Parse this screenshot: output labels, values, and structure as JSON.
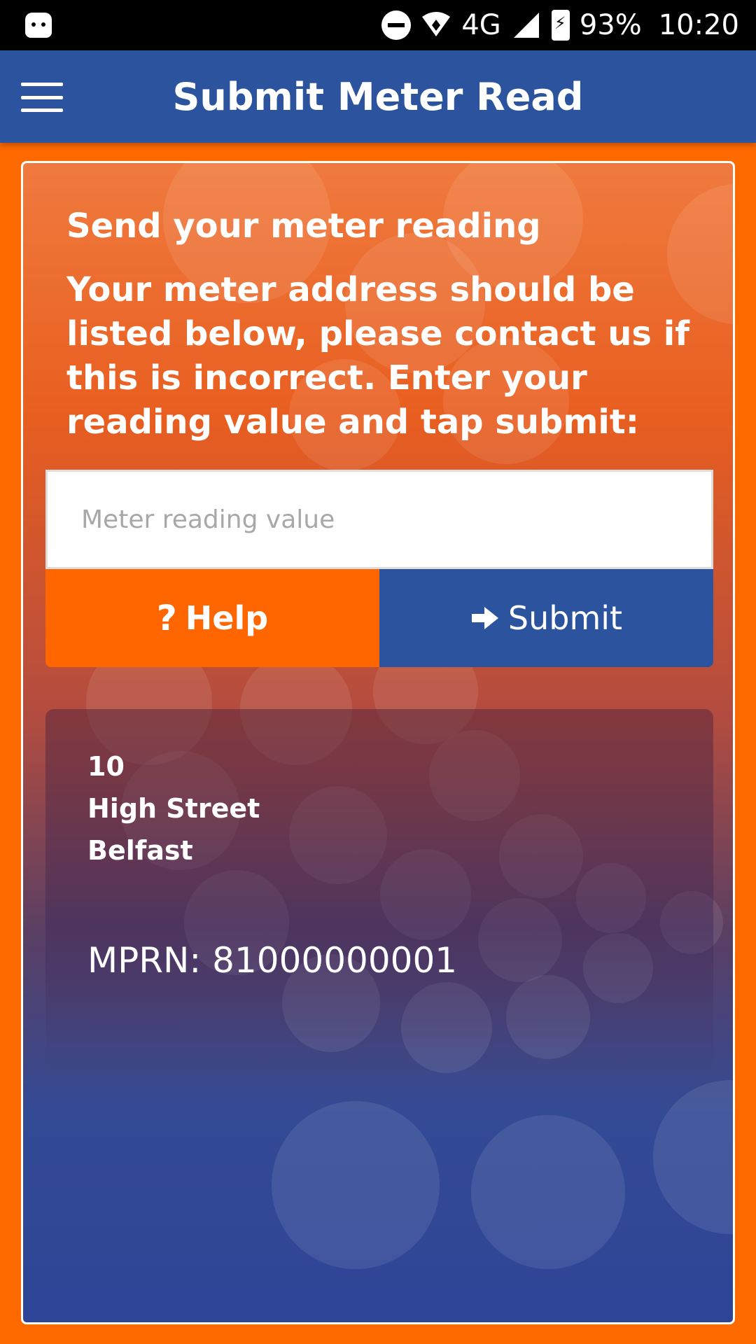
{
  "status_bar": {
    "battery": "93%",
    "time": "10:20",
    "network": "4G"
  },
  "header": {
    "title": "Submit Meter Read"
  },
  "form": {
    "heading": "Send your meter reading",
    "intro": "Your meter address should be listed below, please contact us if this is incorrect. Enter your reading value and tap submit:",
    "input_placeholder": "Meter reading value",
    "input_value": "",
    "help_label": "Help",
    "help_icon": "?",
    "submit_label": "Submit"
  },
  "address": {
    "line1": "10",
    "line2": "High Street",
    "line3": "Belfast",
    "mprn": "MPRN: 81000000001"
  },
  "colors": {
    "brand_blue": "#2c539e",
    "brand_orange": "#ff6600"
  }
}
